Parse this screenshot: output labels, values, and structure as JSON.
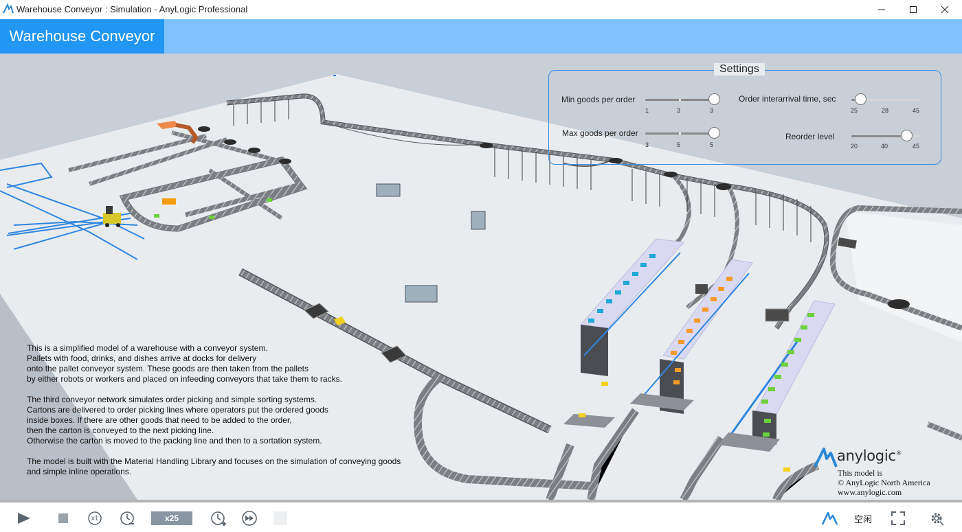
{
  "window": {
    "title": "Warehouse Conveyor : Simulation - AnyLogic Professional",
    "minimize_glyph": "—",
    "maximize_glyph": "☐",
    "close_glyph": "✕"
  },
  "header": {
    "model_title": "Warehouse Conveyor"
  },
  "settings": {
    "legend": "Settings",
    "params": [
      {
        "label": "Min goods per order",
        "ticks": [
          "1",
          "3",
          "3"
        ],
        "value_fraction": 1.0
      },
      {
        "label": "Max goods per order",
        "ticks": [
          "3",
          "5",
          "5"
        ],
        "value_fraction": 1.0
      },
      {
        "label": "Order interarrival time, sec",
        "ticks": [
          "25",
          "28",
          "45"
        ],
        "value_fraction": 0.13
      },
      {
        "label": "Reorder level",
        "ticks": [
          "20",
          "40",
          "45"
        ],
        "value_fraction": 0.8
      }
    ]
  },
  "description": {
    "paragraphs": [
      "This is a simplified model of a warehouse with a conveyor system.\nPallets with food, drinks, and dishes arrive at docks for delivery\nonto the pallet conveyor system. These goods are then taken from the pallets\nby either robots or workers and placed on infeeding conveyors that take them to racks.",
      "The third conveyor network simulates order picking and simple sorting systems.\nCartons are delivered to order picking lines where operators put the ordered goods\ninside boxes. If there are other goods that need to be added to the order,\nthen the carton is conveyed to the next picking line.\nOtherwise the carton is moved to the packing line and then to a sortation system.",
      "The model is built with the Material Handling Library and focuses on the simulation of conveying goods\nand simple inline operations."
    ]
  },
  "branding": {
    "logo_text": "anylogic",
    "registered_mark": "®",
    "line1": "This model is",
    "line2": "© AnyLogic North America",
    "line3": "www.anylogic.com"
  },
  "toolbar": {
    "run_icon": "play-icon",
    "stop_icon": "stop-icon",
    "realtime_label": "x1",
    "speed_label": "x25",
    "status": "空闲"
  },
  "colors": {
    "accent": "#2196f3",
    "header_band": "#80c1ff",
    "settings_border": "#3a8ee6",
    "floor": "#e9ecef",
    "rack_lavender": "#d9daf2",
    "box_cyan": "#1fa8d8",
    "box_orange": "#f59a2a",
    "box_green": "#6cd13a",
    "pallet_yellow": "#f2d21c"
  }
}
